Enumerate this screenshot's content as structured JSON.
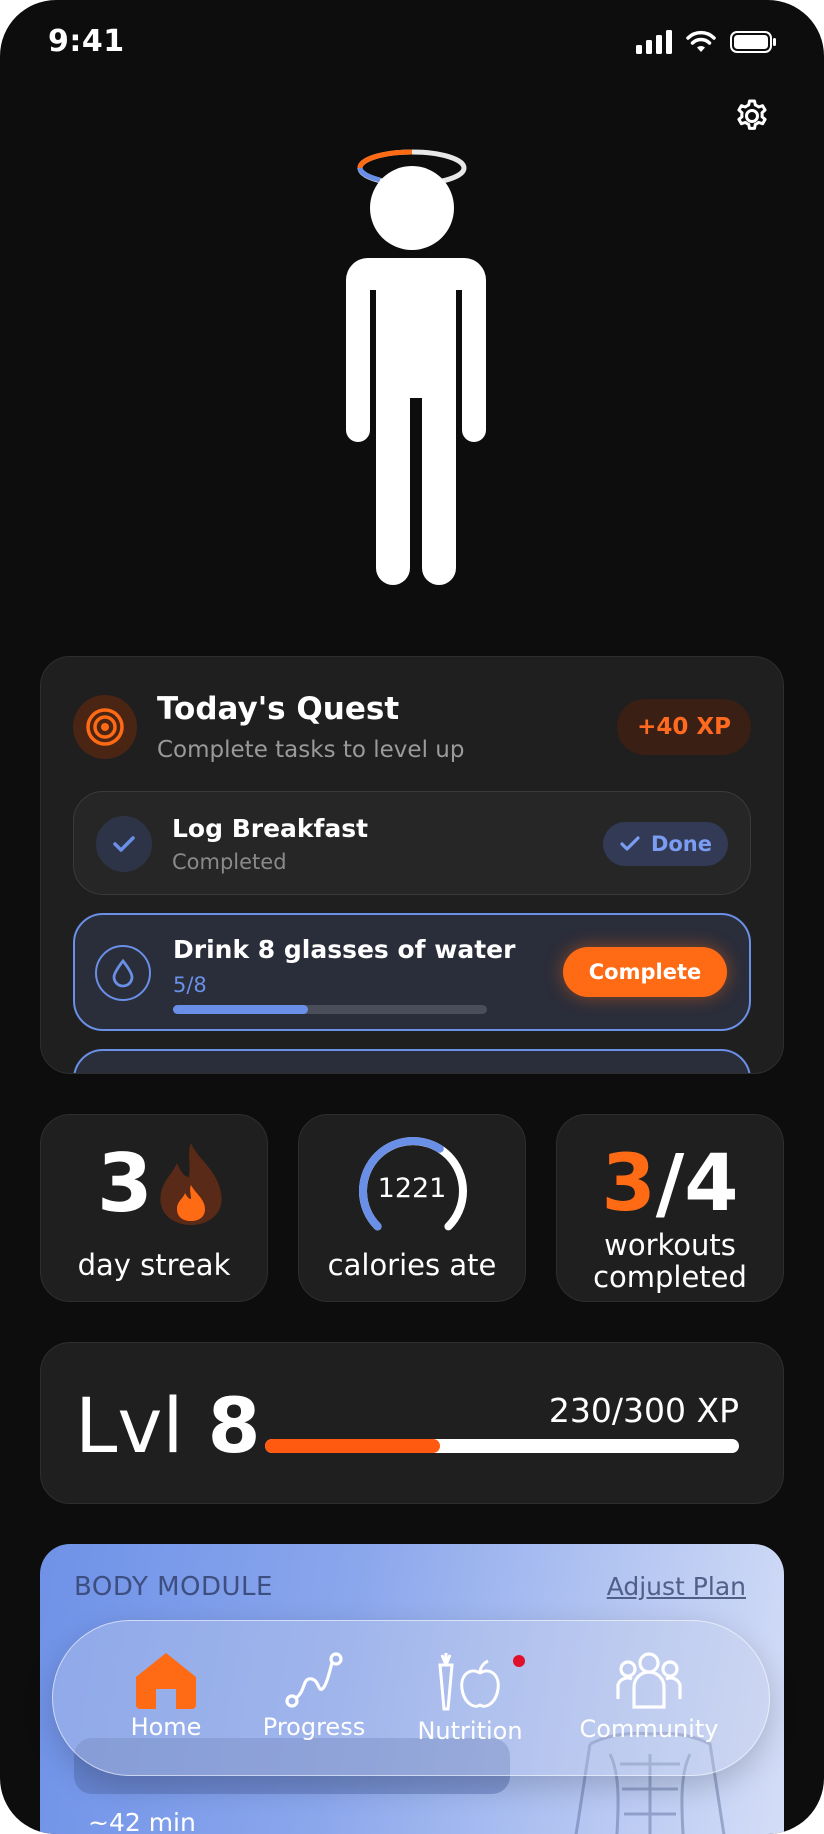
{
  "status_bar": {
    "time": "9:41"
  },
  "quest": {
    "title": "Today's Quest",
    "subtitle": "Complete tasks to level up",
    "xp_badge": "+40 XP",
    "tasks": [
      {
        "title": "Log Breakfast",
        "status": "Completed",
        "action": "Done"
      },
      {
        "title": "Drink 8 glasses of water",
        "progress_text": "5/8",
        "progress": 0.43,
        "action": "Complete"
      }
    ]
  },
  "stats": {
    "streak": {
      "value": "3",
      "label": "day streak"
    },
    "calories": {
      "value": "1221",
      "label": "calories ate",
      "ring_fraction": 0.62
    },
    "workouts": {
      "done": "3",
      "total": "/4",
      "label_line1": "workouts",
      "label_line2": "completed"
    }
  },
  "level": {
    "label": "Lvl",
    "value": "8",
    "xp_text": "230/300 XP",
    "progress": 0.37
  },
  "body_module": {
    "title": "BODY MODULE",
    "link": "Adjust Plan",
    "duration": "~42 min"
  },
  "tab_bar": {
    "tabs": [
      {
        "label": "Home",
        "icon": "home-icon",
        "active": true
      },
      {
        "label": "Progress",
        "icon": "progress-icon"
      },
      {
        "label": "Nutrition",
        "icon": "nutrition-icon",
        "badge": true
      },
      {
        "label": "Community",
        "icon": "community-icon"
      }
    ]
  },
  "colors": {
    "accent": "#ff6a14",
    "blue": "#6a8fe6",
    "background": "#0d0d0d",
    "card": "#1f1f1f"
  }
}
